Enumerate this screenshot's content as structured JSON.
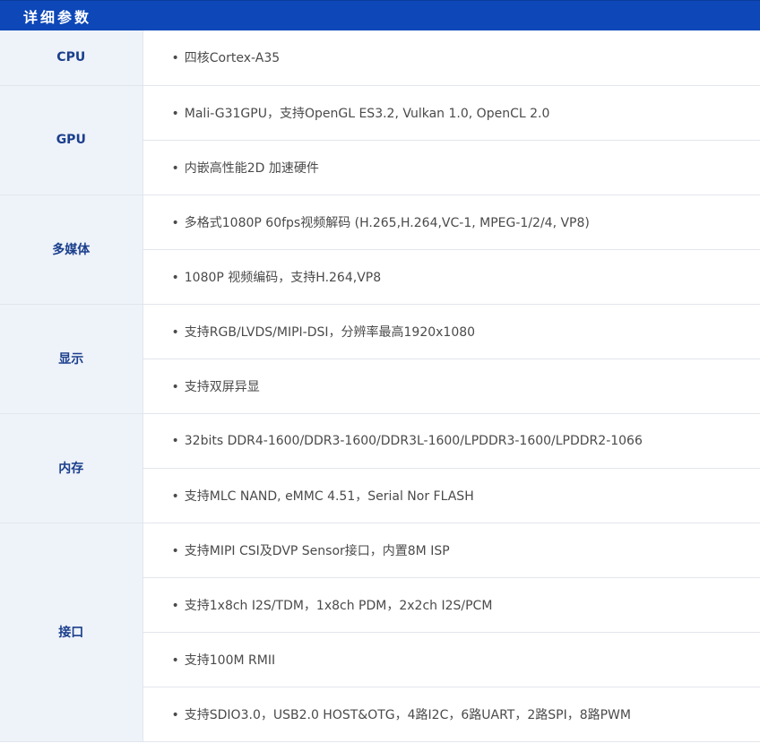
{
  "header": {
    "title": "详细参数"
  },
  "rows": [
    {
      "category": "CPU",
      "items": [
        "四核Cortex-A35"
      ]
    },
    {
      "category": "GPU",
      "items": [
        "Mali-G31GPU，支持OpenGL ES3.2, Vulkan 1.0, OpenCL 2.0",
        "内嵌高性能2D 加速硬件"
      ]
    },
    {
      "category": "多媒体",
      "items": [
        "多格式1080P 60fps视频解码 (H.265,H.264,VC-1, MPEG-1/2/4, VP8)",
        "1080P 视频编码，支持H.264,VP8"
      ]
    },
    {
      "category": "显示",
      "items": [
        "支持RGB/LVDS/MIPI-DSI，分辨率最高1920x1080",
        "支持双屏异显"
      ]
    },
    {
      "category": "内存",
      "items": [
        "32bits DDR4-1600/DDR3-1600/DDR3L-1600/LPDDR3-1600/LPDDR2-1066",
        "支持MLC NAND, eMMC 4.51，Serial Nor FLASH"
      ]
    },
    {
      "category": "接口",
      "items": [
        "支持MIPI CSI及DVP Sensor接口，内置8M ISP",
        "支持1x8ch I2S/TDM，1x8ch PDM，2x2ch I2S/PCM",
        "支持100M RMII",
        "支持SDIO3.0，USB2.0 HOST&OTG，4路I2C，6路UART，2路SPI，8路PWM"
      ]
    }
  ],
  "bullet_char": "•"
}
